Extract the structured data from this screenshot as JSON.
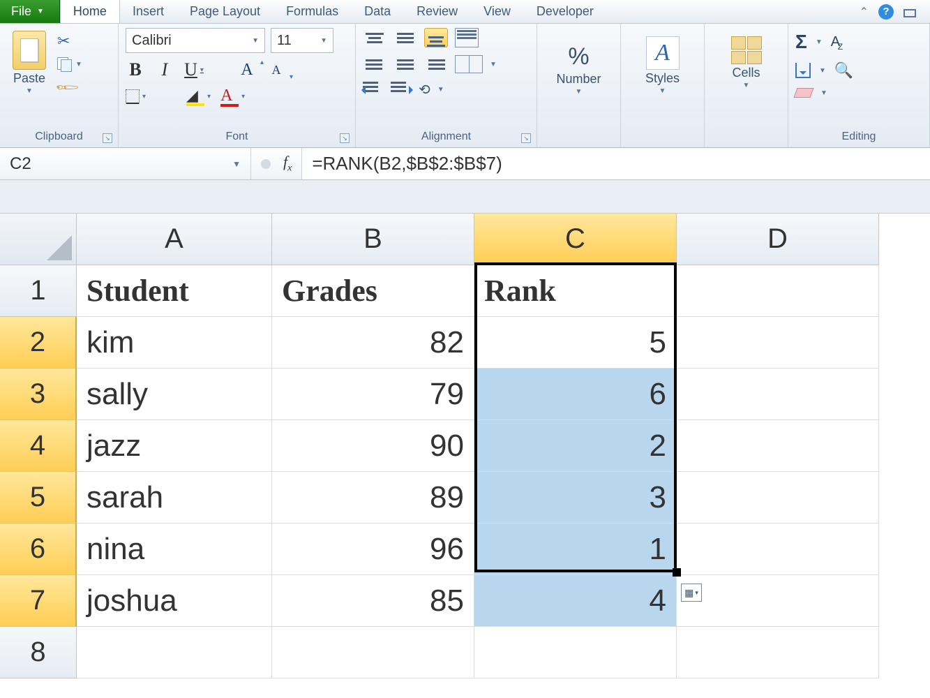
{
  "tabs": {
    "file": "File",
    "items": [
      "Home",
      "Insert",
      "Page Layout",
      "Formulas",
      "Data",
      "Review",
      "View",
      "Developer"
    ],
    "active": "Home"
  },
  "ribbon": {
    "clipboard": {
      "paste": "Paste",
      "label": "Clipboard"
    },
    "font": {
      "name": "Calibri",
      "size": "11",
      "label": "Font"
    },
    "alignment": {
      "label": "Alignment"
    },
    "number": {
      "label": "Number",
      "btn": "%"
    },
    "styles": {
      "label": "Styles"
    },
    "cells": {
      "label": "Cells"
    },
    "editing": {
      "label": "Editing"
    }
  },
  "formula_bar": {
    "name_box": "C2",
    "fx": "fx",
    "formula": "=RANK(B2,$B$2:$B$7)"
  },
  "columns": [
    "A",
    "B",
    "C",
    "D"
  ],
  "row_numbers": [
    "1",
    "2",
    "3",
    "4",
    "5",
    "6",
    "7",
    "8"
  ],
  "selected_column": "C",
  "headers": {
    "A": "Student",
    "B": "Grades",
    "C": "Rank"
  },
  "rows": [
    {
      "student": "kim",
      "grade": "82",
      "rank": "5"
    },
    {
      "student": "sally",
      "grade": "79",
      "rank": "6"
    },
    {
      "student": "jazz",
      "grade": "90",
      "rank": "2"
    },
    {
      "student": "sarah",
      "grade": "89",
      "rank": "3"
    },
    {
      "student": "nina",
      "grade": "96",
      "rank": "1"
    },
    {
      "student": "joshua",
      "grade": "85",
      "rank": "4"
    }
  ]
}
